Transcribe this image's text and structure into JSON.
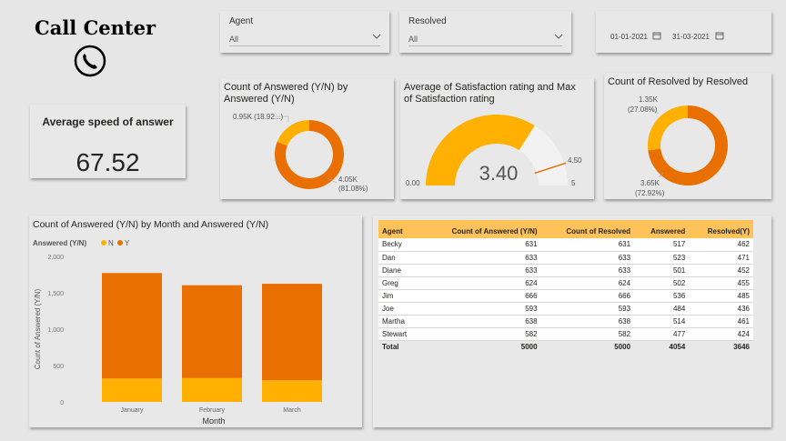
{
  "dashboard_title": "Call Center",
  "slicers": {
    "agent": {
      "label": "Agent",
      "value": "All"
    },
    "resolved": {
      "label": "Resolved",
      "value": "All"
    },
    "date_start": "01-01-2021",
    "date_end": "31-03-2021"
  },
  "kpi": {
    "title": "Average speed of answer",
    "value": "67.52"
  },
  "colors": {
    "orange_dark": "#e86f00",
    "orange_light": "#ffb000",
    "gauge_track": "#f2f2f2",
    "table_header": "#ffc35a"
  },
  "donut_answered": {
    "title": "Count of Answered (Y/N) by Answered (Y/N)",
    "label_small": "0.95K (18.92...)",
    "label_large_value": "4.05K",
    "label_large_pct": "(81.08%)"
  },
  "gauge": {
    "title": "Average of Satisfaction rating and Max of Satisfaction rating",
    "value_label": "3.40",
    "min_label": "0.00",
    "max_label": "5",
    "target_label": "4.50"
  },
  "donut_resolved": {
    "title": "Count of Resolved by Resolved",
    "label_small_value": "1.35K",
    "label_small_pct": "(27.08%)",
    "label_large_value": "3.65K",
    "label_large_pct": "(72.92%)"
  },
  "table": {
    "headers": [
      "Agent",
      "Count of Answered (Y/N)",
      "Count of Resolved",
      "Answered",
      "Resolved(Y)"
    ],
    "rows": [
      [
        "Becky",
        "631",
        "631",
        "517",
        "462"
      ],
      [
        "Dan",
        "633",
        "633",
        "523",
        "471"
      ],
      [
        "Diane",
        "633",
        "633",
        "501",
        "452"
      ],
      [
        "Greg",
        "624",
        "624",
        "502",
        "455"
      ],
      [
        "Jim",
        "666",
        "666",
        "536",
        "485"
      ],
      [
        "Joe",
        "593",
        "593",
        "484",
        "436"
      ],
      [
        "Martha",
        "638",
        "638",
        "514",
        "461"
      ],
      [
        "Stewart",
        "582",
        "582",
        "477",
        "424"
      ]
    ],
    "total": [
      "Total",
      "5000",
      "5000",
      "4054",
      "3646"
    ]
  },
  "chart_data": [
    {
      "type": "pie",
      "title": "Count of Answered (Y/N) by Answered (Y/N)",
      "categories": [
        "N",
        "Y"
      ],
      "values": [
        0.95,
        4.05
      ],
      "units": "K",
      "percent": [
        18.92,
        81.08
      ]
    },
    {
      "type": "gauge",
      "title": "Average of Satisfaction rating and Max of Satisfaction rating",
      "value": 3.4,
      "min": 0,
      "max": 5,
      "target": 4.5
    },
    {
      "type": "pie",
      "title": "Count of Resolved by Resolved",
      "categories": [
        "N",
        "Y"
      ],
      "values": [
        1.35,
        3.65
      ],
      "units": "K",
      "percent": [
        27.08,
        72.92
      ]
    },
    {
      "type": "bar",
      "stacked": true,
      "title": "Count of Answered (Y/N) by Month and Answered (Y/N)",
      "legend_title": "Answered (Y/N)",
      "categories": [
        "January",
        "February",
        "March"
      ],
      "series": [
        {
          "name": "N",
          "values": [
            322,
            327,
            297
          ],
          "color": "#ffb000"
        },
        {
          "name": "Y",
          "values": [
            1450,
            1277,
            1327
          ],
          "color": "#e86f00"
        }
      ],
      "xlabel": "Month",
      "ylabel": "Count of Answered (Y/N)",
      "ylim": [
        0,
        2000
      ],
      "yticks": [
        "0",
        "500",
        "1,000",
        "1,500",
        "2,000"
      ],
      "grid": false
    }
  ]
}
